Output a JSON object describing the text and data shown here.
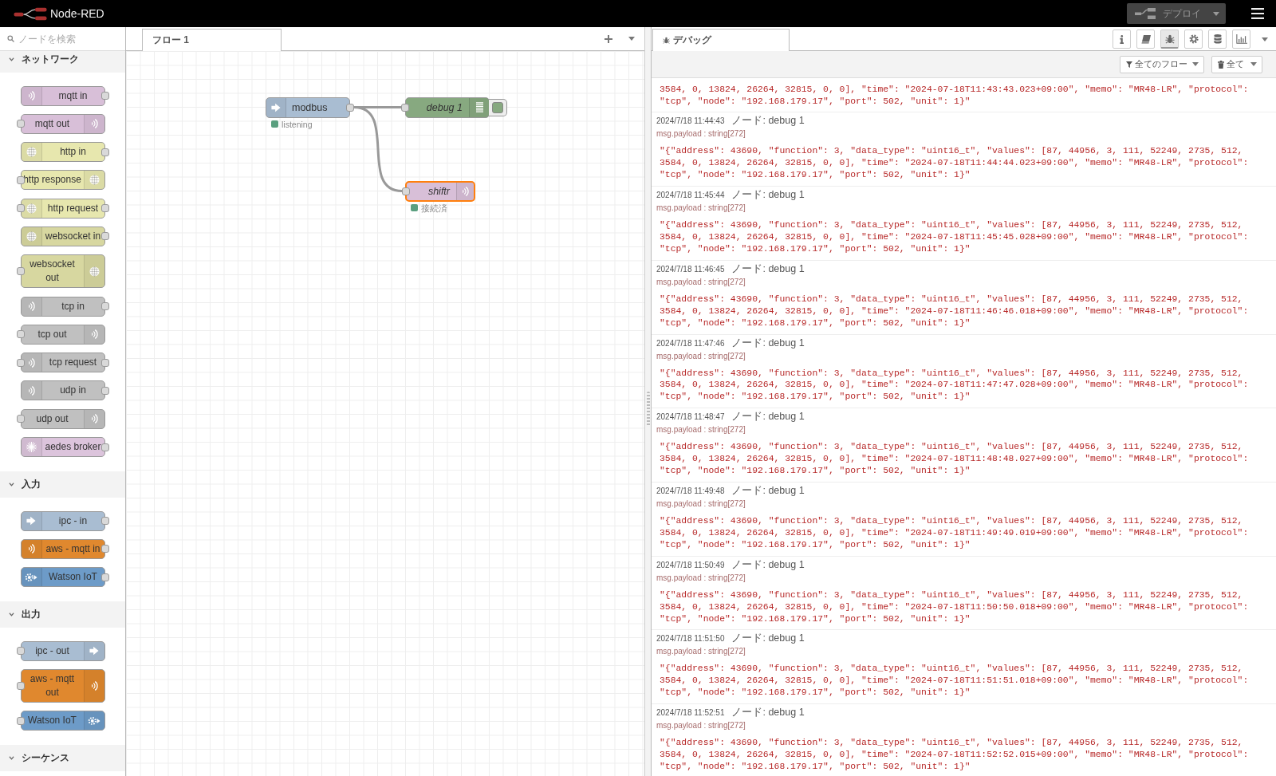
{
  "header": {
    "title": "Node-RED",
    "deploy": {
      "label": "デプロイ",
      "disabled": true
    }
  },
  "palette": {
    "search": {
      "placeholder": "ノードを検索"
    },
    "categories": [
      {
        "label": "ネットワーク",
        "expanded": true,
        "nodes": [
          {
            "label": "mqtt in",
            "kind": "input",
            "color": "#d8bfd8"
          },
          {
            "label": "mqtt out",
            "kind": "output",
            "color": "#d8bfd8"
          },
          {
            "label": "http in",
            "kind": "input",
            "color": "#e7e7ae"
          },
          {
            "label": "http response",
            "kind": "output",
            "color": "#e7e7ae"
          },
          {
            "label": "http request",
            "kind": "request",
            "color": "#e7e7ae"
          },
          {
            "label": "websocket in",
            "kind": "input",
            "color": "#d7d7a0"
          },
          {
            "label": "websocket out",
            "kind": "output",
            "color": "#d7d7a0"
          },
          {
            "label": "tcp in",
            "kind": "input",
            "color": "#c0c0c0"
          },
          {
            "label": "tcp out",
            "kind": "output",
            "color": "#c0c0c0"
          },
          {
            "label": "tcp request",
            "kind": "request",
            "color": "#c0c0c0"
          },
          {
            "label": "udp in",
            "kind": "input",
            "color": "#c0c0c0"
          },
          {
            "label": "udp out",
            "kind": "output",
            "color": "#c0c0c0"
          },
          {
            "label": "aedes broker",
            "kind": "input",
            "color": "#dcc4dc"
          }
        ]
      },
      {
        "label": "入力",
        "expanded": true,
        "nodes": [
          {
            "label": "ipc - in",
            "kind": "input",
            "color": "#a9bdd2"
          },
          {
            "label": "aws - mqtt in",
            "kind": "input",
            "color": "#e0882e"
          },
          {
            "label": "Watson IoT",
            "kind": "input",
            "color": "#6d9bc8"
          }
        ]
      },
      {
        "label": "出力",
        "expanded": true,
        "nodes": [
          {
            "label": "ipc - out",
            "kind": "output",
            "color": "#a9bdd2"
          },
          {
            "label": "aws - mqtt out",
            "kind": "output",
            "color": "#e0882e"
          },
          {
            "label": "Watson IoT",
            "kind": "output",
            "color": "#6d9bc8"
          }
        ]
      },
      {
        "label": "シーケンス",
        "expanded": true
      }
    ]
  },
  "workspace": {
    "tabs": [
      {
        "label": "フロー 1",
        "selected": true
      }
    ],
    "nodes": [
      {
        "label": "modbus",
        "kind": "input",
        "color": "#a9bdd2",
        "italic": false,
        "selected": false,
        "status": {
          "text": "listening",
          "color": "#5a9f7f"
        }
      },
      {
        "label": "debug 1",
        "kind": "debug",
        "color": "#87a980",
        "italic": true,
        "selected": false,
        "active": true
      },
      {
        "label": "shiftr",
        "kind": "output",
        "color": "#d8bfd8",
        "italic": true,
        "selected": true,
        "status": {
          "text": "接続済",
          "color": "#5a9f7f"
        }
      }
    ]
  },
  "sidebar": {
    "title": "デバッグ",
    "tab_buttons": [
      {
        "kind": "info",
        "selected": false
      },
      {
        "kind": "help",
        "selected": false
      },
      {
        "kind": "debug",
        "selected": true
      },
      {
        "kind": "config",
        "selected": false
      },
      {
        "kind": "context",
        "selected": false
      },
      {
        "kind": "dashboard",
        "selected": false
      }
    ],
    "filter": "全てのフロー",
    "clear": "全て",
    "messages": [
      {
        "payload": "3584, 0, 13824, 26264, 32815, 0, 0], \"time\": \"2024-07-18T11:43:43.023+09:00\", \"memo\": \"MR48-LR\", \"protocol\": \"tcp\", \"node\": \"192.168.179.17\", \"port\": 502, \"unit\": 1}\""
      },
      {
        "date": "2024/7/18 11:44:43",
        "node": "ノード: debug 1",
        "meta": "msg.payload : string[272]",
        "payload": "\"{\"address\": 43690, \"function\": 3, \"data_type\": \"uint16_t\", \"values\": [87, 44956, 3, 111, 52249, 2735, 512, 3584, 0, 13824, 26264, 32815, 0, 0], \"time\": \"2024-07-18T11:44:44.023+09:00\", \"memo\": \"MR48-LR\", \"protocol\": \"tcp\", \"node\": \"192.168.179.17\", \"port\": 502, \"unit\": 1}\""
      },
      {
        "date": "2024/7/18 11:45:44",
        "node": "ノード: debug 1",
        "meta": "msg.payload : string[272]",
        "payload": "\"{\"address\": 43690, \"function\": 3, \"data_type\": \"uint16_t\", \"values\": [87, 44956, 3, 111, 52249, 2735, 512, 3584, 0, 13824, 26264, 32815, 0, 0], \"time\": \"2024-07-18T11:45:45.028+09:00\", \"memo\": \"MR48-LR\", \"protocol\": \"tcp\", \"node\": \"192.168.179.17\", \"port\": 502, \"unit\": 1}\""
      },
      {
        "date": "2024/7/18 11:46:45",
        "node": "ノード: debug 1",
        "meta": "msg.payload : string[272]",
        "payload": "\"{\"address\": 43690, \"function\": 3, \"data_type\": \"uint16_t\", \"values\": [87, 44956, 3, 111, 52249, 2735, 512, 3584, 0, 13824, 26264, 32815, 0, 0], \"time\": \"2024-07-18T11:46:46.018+09:00\", \"memo\": \"MR48-LR\", \"protocol\": \"tcp\", \"node\": \"192.168.179.17\", \"port\": 502, \"unit\": 1}\""
      },
      {
        "date": "2024/7/18 11:47:46",
        "node": "ノード: debug 1",
        "meta": "msg.payload : string[272]",
        "payload": "\"{\"address\": 43690, \"function\": 3, \"data_type\": \"uint16_t\", \"values\": [87, 44956, 3, 111, 52249, 2735, 512, 3584, 0, 13824, 26264, 32815, 0, 0], \"time\": \"2024-07-18T11:47:47.028+09:00\", \"memo\": \"MR48-LR\", \"protocol\": \"tcp\", \"node\": \"192.168.179.17\", \"port\": 502, \"unit\": 1}\""
      },
      {
        "date": "2024/7/18 11:48:47",
        "node": "ノード: debug 1",
        "meta": "msg.payload : string[272]",
        "payload": "\"{\"address\": 43690, \"function\": 3, \"data_type\": \"uint16_t\", \"values\": [87, 44956, 3, 111, 52249, 2735, 512, 3584, 0, 13824, 26264, 32815, 0, 0], \"time\": \"2024-07-18T11:48:48.027+09:00\", \"memo\": \"MR48-LR\", \"protocol\": \"tcp\", \"node\": \"192.168.179.17\", \"port\": 502, \"unit\": 1}\""
      },
      {
        "date": "2024/7/18 11:49:48",
        "node": "ノード: debug 1",
        "meta": "msg.payload : string[272]",
        "payload": "\"{\"address\": 43690, \"function\": 3, \"data_type\": \"uint16_t\", \"values\": [87, 44956, 3, 111, 52249, 2735, 512, 3584, 0, 13824, 26264, 32815, 0, 0], \"time\": \"2024-07-18T11:49:49.019+09:00\", \"memo\": \"MR48-LR\", \"protocol\": \"tcp\", \"node\": \"192.168.179.17\", \"port\": 502, \"unit\": 1}\""
      },
      {
        "date": "2024/7/18 11:50:49",
        "node": "ノード: debug 1",
        "meta": "msg.payload : string[272]",
        "payload": "\"{\"address\": 43690, \"function\": 3, \"data_type\": \"uint16_t\", \"values\": [87, 44956, 3, 111, 52249, 2735, 512, 3584, 0, 13824, 26264, 32815, 0, 0], \"time\": \"2024-07-18T11:50:50.018+09:00\", \"memo\": \"MR48-LR\", \"protocol\": \"tcp\", \"node\": \"192.168.179.17\", \"port\": 502, \"unit\": 1}\""
      },
      {
        "date": "2024/7/18 11:51:50",
        "node": "ノード: debug 1",
        "meta": "msg.payload : string[272]",
        "payload": "\"{\"address\": 43690, \"function\": 3, \"data_type\": \"uint16_t\", \"values\": [87, 44956, 3, 111, 52249, 2735, 512, 3584, 0, 13824, 26264, 32815, 0, 0], \"time\": \"2024-07-18T11:51:51.018+09:00\", \"memo\": \"MR48-LR\", \"protocol\": \"tcp\", \"node\": \"192.168.179.17\", \"port\": 502, \"unit\": 1}\""
      },
      {
        "date": "2024/7/18 11:52:51",
        "node": "ノード: debug 1",
        "meta": "msg.payload : string[272]",
        "payload": "\"{\"address\": 43690, \"function\": 3, \"data_type\": \"uint16_t\", \"values\": [87, 44956, 3, 111, 52249, 2735, 512, 3584, 0, 13824, 26264, 32815, 0, 0], \"time\": \"2024-07-18T11:52:52.015+09:00\", \"memo\": \"MR48-LR\", \"protocol\": \"tcp\", \"node\": \"192.168.179.17\", \"port\": 502, \"unit\": 1}\""
      }
    ]
  }
}
